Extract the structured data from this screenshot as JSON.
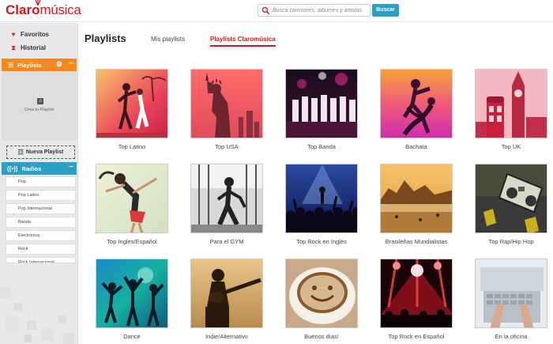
{
  "header": {
    "logo_primary": "Claro",
    "logo_secondary": "música",
    "search_placeholder": "Busca canciones, álbumes y artistas",
    "search_button": "Buscar"
  },
  "sidebar": {
    "favoritos": "Favoritos",
    "historial": "Historial",
    "playlists": "Playlists",
    "create_playlist_text": "Crea tu Playlist",
    "new_playlist": "Nueva Playlist",
    "radios": "Radios",
    "radio_items": [
      "Pop",
      "Pop Latino",
      "Pop Internacional",
      "Banda",
      "Electrónica",
      "Rock",
      "Rock Internacional"
    ]
  },
  "main": {
    "title": "Playlists",
    "tabs": [
      {
        "label": "Mis playlists",
        "active": false
      },
      {
        "label": "Playlists Claromúsica",
        "active": true
      }
    ],
    "playlists": [
      {
        "name": "Top Latino",
        "icon": "dancing-couple-image"
      },
      {
        "name": "Top USA",
        "icon": "statue-of-liberty-image"
      },
      {
        "name": "Top Banda",
        "icon": "band-on-stage-image"
      },
      {
        "name": "Bachata",
        "icon": "bachata-dancers-image"
      },
      {
        "name": "Top UK",
        "icon": "big-ben-image"
      },
      {
        "name": "Top Inglés/Español",
        "icon": "dancing-girl-image"
      },
      {
        "name": "Para el GYM",
        "icon": "gym-workout-image"
      },
      {
        "name": "Top Rock en Inglés",
        "icon": "rock-concert-image"
      },
      {
        "name": "Brasileñas Mundialistas",
        "icon": "rio-beach-image"
      },
      {
        "name": "Top Rap/Hip Hop",
        "icon": "boombox-image"
      },
      {
        "name": "Dance",
        "icon": "dance-crowd-image"
      },
      {
        "name": "Indie/Alternativo",
        "icon": "guitarist-silhouette-image"
      },
      {
        "name": "Buenos días!",
        "icon": "coffee-smiley-image"
      },
      {
        "name": "Top Rock en Español",
        "icon": "stage-lights-image"
      },
      {
        "name": "En la oficina",
        "icon": "laptop-typing-image"
      }
    ]
  },
  "colors": {
    "brand_red": "#d7161e",
    "accent_orange": "#f28a20",
    "accent_blue": "#2b9fc7"
  }
}
